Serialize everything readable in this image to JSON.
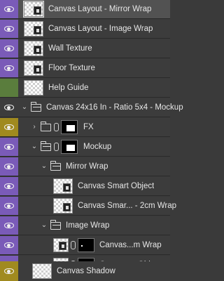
{
  "layers": [
    {
      "name": "Canvas Layout - Mirror Wrap",
      "selected": true,
      "visibility_color": "purple"
    },
    {
      "name": "Canvas Layout - Image Wrap",
      "visibility_color": "purple"
    },
    {
      "name": "Wall Texture",
      "visibility_color": "purple"
    },
    {
      "name": "Floor Texture",
      "visibility_color": "purple"
    },
    {
      "name": "Help Guide",
      "visibility_color": "green",
      "hidden": true
    },
    {
      "name": "Canvas 24x16 In - Ratio 5x4 - Mockup",
      "type": "group",
      "expanded": true
    },
    {
      "name": "FX",
      "type": "group",
      "expanded": false,
      "visibility_color": "gold"
    },
    {
      "name": "Mockup",
      "type": "group",
      "expanded": true,
      "visibility_color": "purple"
    },
    {
      "name": "Mirror Wrap",
      "type": "group",
      "expanded": true,
      "visibility_color": "purple"
    },
    {
      "name": "Canvas Smart Object",
      "visibility_color": "purple"
    },
    {
      "name": "Canvas Smar... - 2cm Wrap",
      "visibility_color": "purple"
    },
    {
      "name": "Image Wrap",
      "type": "group",
      "expanded": true,
      "visibility_color": "purple"
    },
    {
      "name": "Canvas...m Wrap",
      "visibility_color": "purple"
    },
    {
      "name": "Canvas ... Object",
      "visibility_color": "purple"
    },
    {
      "name": "Canvas Shadow",
      "visibility_color": "gold"
    }
  ],
  "icons": {
    "visibility": "eye-icon",
    "group": "folder-icon",
    "link": "chain-link-icon",
    "expand": "chevron-right-icon",
    "collapse": "chevron-down-icon"
  }
}
